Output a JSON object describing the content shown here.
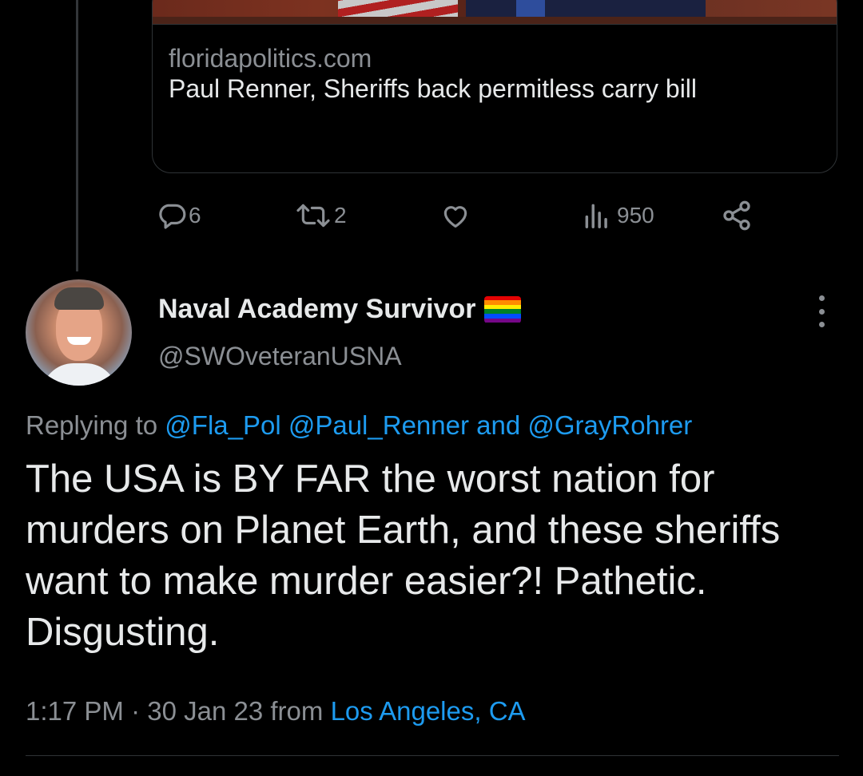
{
  "link_card": {
    "domain": "floridapolitics.com",
    "title": "Paul Renner, Sheriffs back permitless carry bill"
  },
  "actions": {
    "replies": "6",
    "retweets": "2",
    "views": "950",
    "icons": [
      "reply-icon",
      "retweet-icon",
      "like-icon",
      "views-icon",
      "share-icon"
    ]
  },
  "reply_tweet": {
    "display_name": "Naval Academy Survivor",
    "handle": "@SWOveteranUSNA",
    "replying_prefix": "Replying to",
    "mention_1": "@Fla_Pol",
    "mention_2": "@Paul_Renner",
    "replying_and": "and",
    "mention_3": "@GrayRohrer",
    "text": "The USA is BY FAR the worst nation for murders on Planet Earth, and these sheriffs want to make murder easier?! Pathetic. Disgusting.",
    "time": "1:17 PM",
    "separator": "·",
    "date": "30 Jan 23",
    "from": "from",
    "location": "Los Angeles, CA"
  },
  "colors": {
    "background": "#000000",
    "text": "#e7e9ea",
    "muted": "#8b8f94",
    "accent": "#1d9bf0",
    "border": "#2f3336"
  }
}
